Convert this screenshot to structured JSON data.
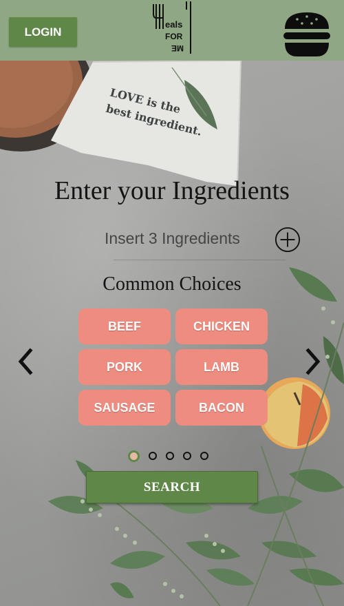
{
  "header": {
    "login_label": "LOGIN",
    "logo_text": "Meals For Me",
    "menu_icon": "hamburger-menu-icon"
  },
  "background": {
    "napkin_line1": "LOVE is the",
    "napkin_line2": "best ingredient."
  },
  "main": {
    "title": "Enter your Ingredients",
    "ingredient_placeholder": "Insert 3 Ingredients",
    "add_icon": "plus-circle-icon",
    "subtitle": "Common Choices",
    "choices": [
      "BEEF",
      "CHICKEN",
      "PORK",
      "LAMB",
      "SAUSAGE",
      "BACON"
    ],
    "prev_icon": "chevron-left-icon",
    "next_icon": "chevron-right-icon",
    "pagination": {
      "count": 5,
      "active": 1
    },
    "search_label": "SEARCH"
  },
  "colors": {
    "header_bg": "#8fa883",
    "button_green": "#5f8748",
    "chip_salmon": "#ee8c80"
  }
}
